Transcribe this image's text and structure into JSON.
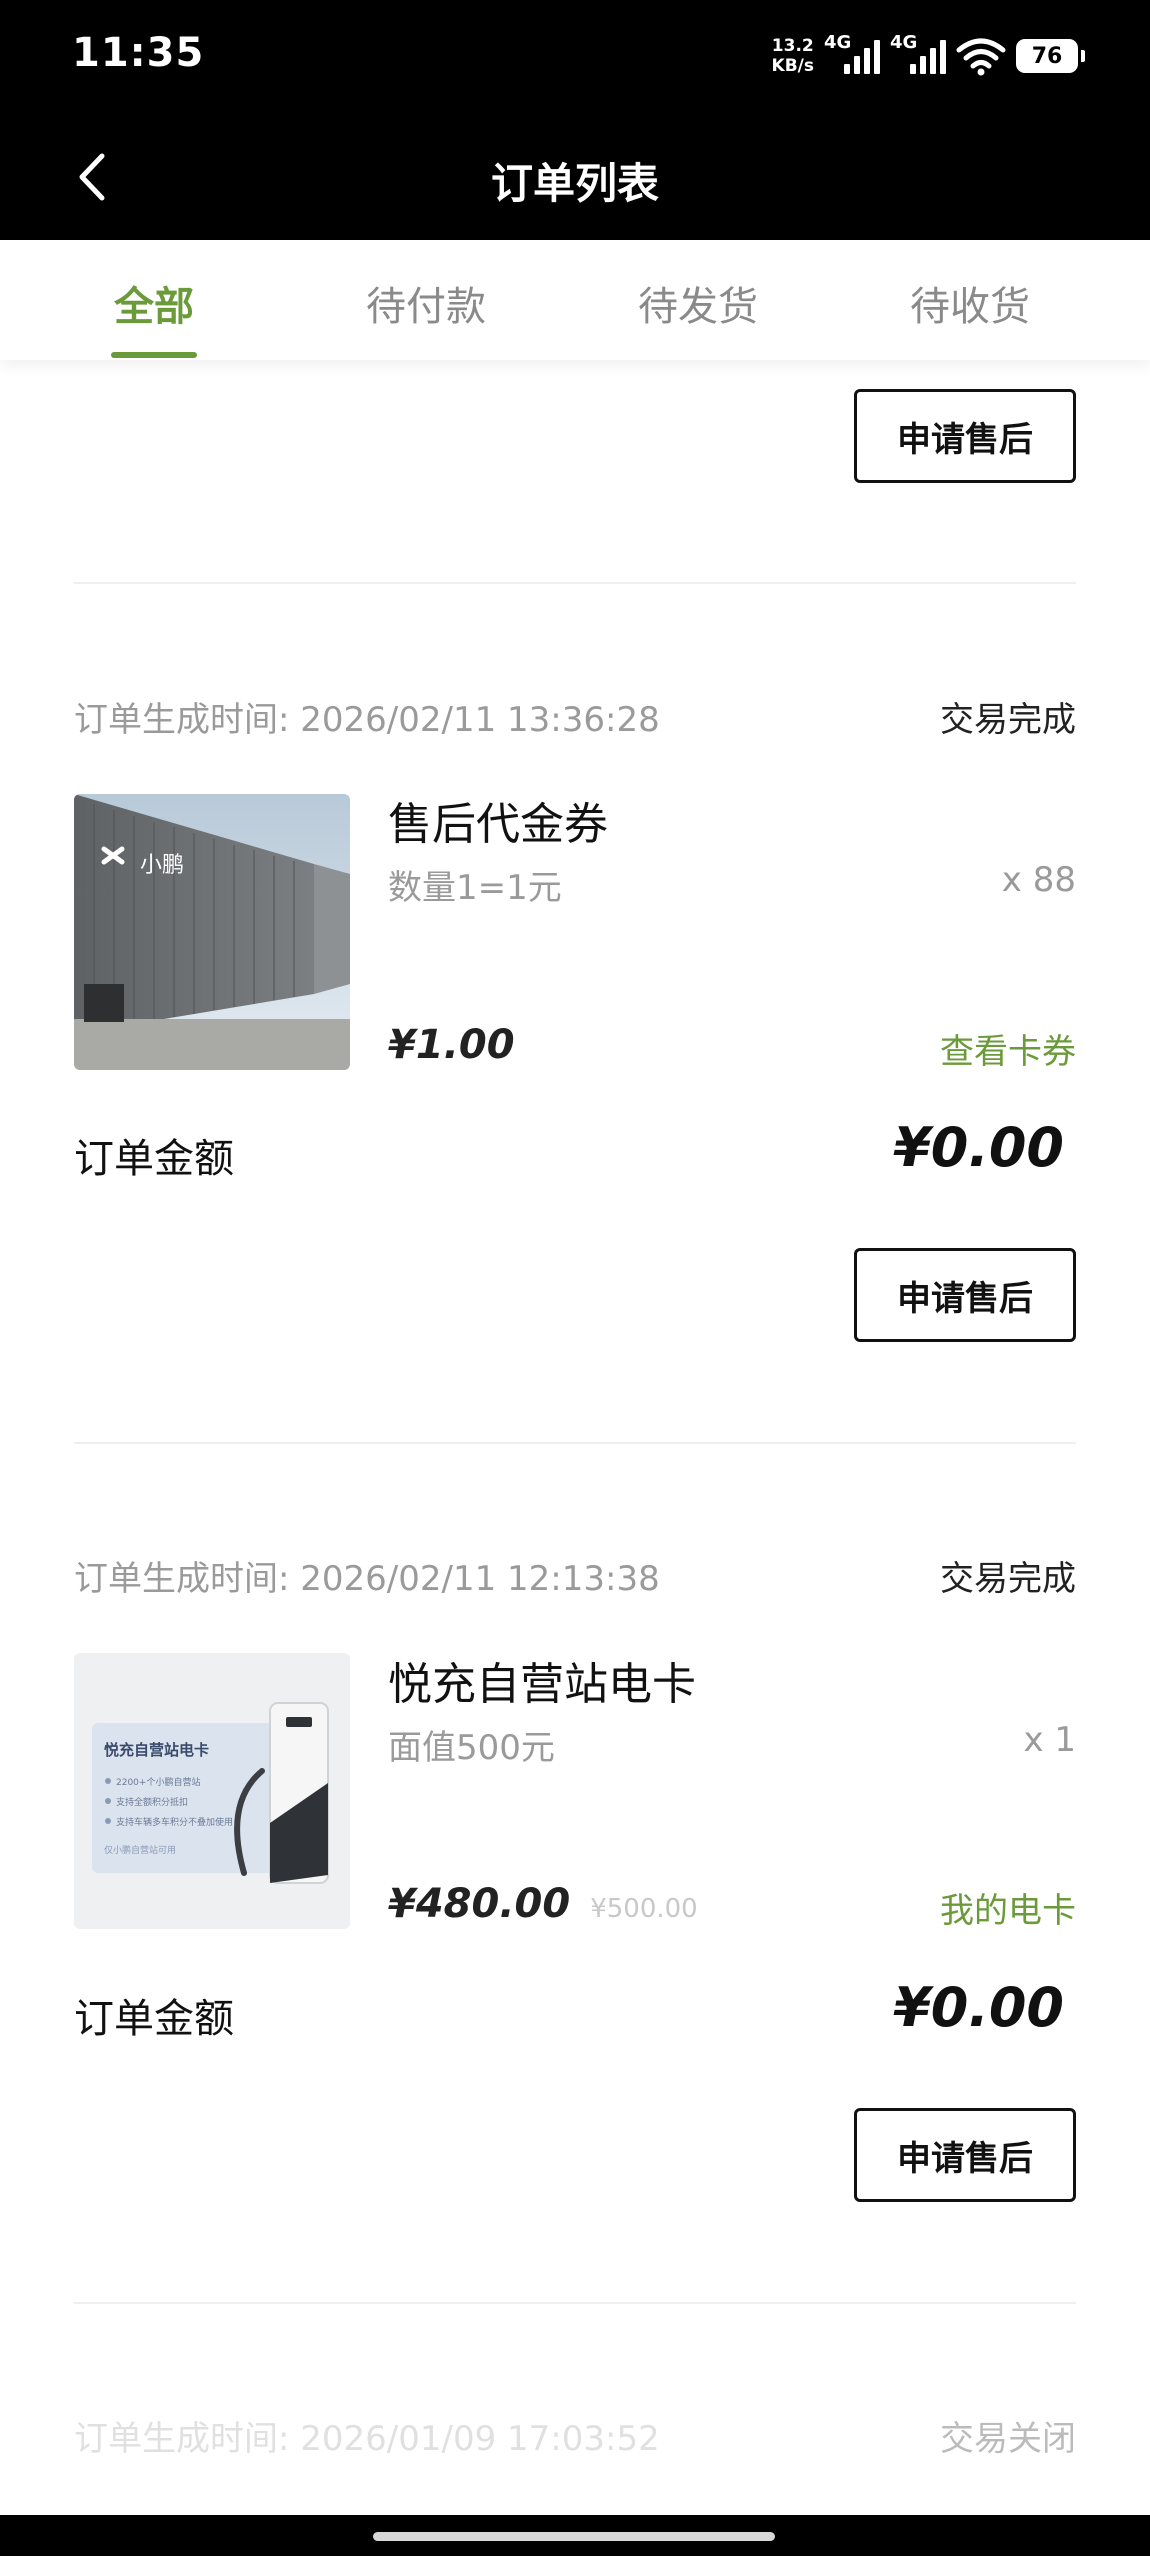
{
  "status_bar": {
    "time": "11:35",
    "net_speed_value": "13.2",
    "net_speed_unit": "KB/s",
    "sim1_label": "4G",
    "sim2_label": "4G",
    "battery": "76"
  },
  "nav": {
    "title": "订单列表"
  },
  "tabs": [
    {
      "label": "全部",
      "active": true
    },
    {
      "label": "待付款",
      "active": false
    },
    {
      "label": "待发货",
      "active": false
    },
    {
      "label": "待收货",
      "active": false
    }
  ],
  "top_partial": {
    "after_sale_label": "申请售后"
  },
  "orders": [
    {
      "time_label": "订单生成时间: 2026/02/11 13:36:28",
      "status": "交易完成",
      "product_name": "售后代金券",
      "spec": "数量1=1元",
      "qty": "x 88",
      "price": "¥1.00",
      "link": "查看卡券",
      "amount_label": "订单金额",
      "amount": "¥0.00",
      "after_sale_label": "申请售后",
      "thumb": "xpeng-building-image"
    },
    {
      "time_label": "订单生成时间: 2026/02/11 12:13:38",
      "status": "交易完成",
      "product_name": "悦充自营站电卡",
      "spec": "面值500元",
      "qty": "x 1",
      "price": "¥480.00",
      "original_price": "¥500.00",
      "link": "我的电卡",
      "amount_label": "订单金额",
      "amount": "¥0.00",
      "after_sale_label": "申请售后",
      "thumb": "charging-card-image",
      "thumb_card_title": "悦充自营站电卡",
      "thumb_card_lines": [
        "2200+个小鹏自营站",
        "支持全额积分抵扣",
        "支持车辆多车积分不叠加使用"
      ],
      "thumb_card_footer": "仅小鹏自营站可用"
    },
    {
      "time_label": "订单生成时间: 2026/01/09 17:03:52",
      "status": "交易关闭"
    }
  ],
  "colors": {
    "accent_green": "#6b9a3a",
    "header_bg": "#000000",
    "muted_text": "#9a9a9a"
  },
  "icons": {
    "back": "chevron-left-icon",
    "wifi": "wifi-icon",
    "signal": "signal-icon",
    "battery": "battery-icon"
  }
}
